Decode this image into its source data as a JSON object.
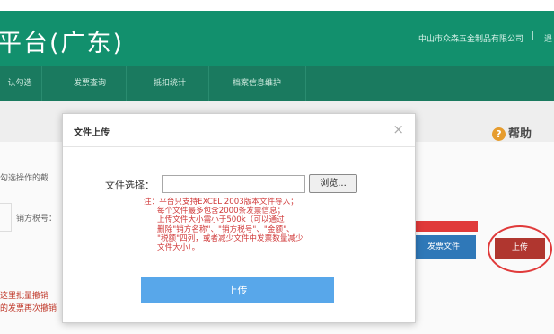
{
  "header": {
    "title": "平台(广东)",
    "company": "中山市众森五金制品有限公司",
    "separator": "|",
    "logout": "退"
  },
  "nav": {
    "items": [
      "认勾选",
      "发票查询",
      "抵扣统计",
      "档案信息维护"
    ]
  },
  "help": {
    "label": "帮助",
    "icon": "help-icon"
  },
  "background": {
    "hint_top": "勾选操作的截",
    "seller_tax_label": "销方税号：",
    "batch_line1": "这里批量撤销",
    "batch_line2": "的发票再次撤销",
    "import_button": "发票文件",
    "upload_button": "上传"
  },
  "modal": {
    "title": "文件上传",
    "close": "×",
    "file_label": "文件选择：",
    "file_value": "",
    "browse": "浏览...",
    "note": [
      "注：平台只支持EXCEL 2003版本文件导入；",
      "每个文件最多包含2000条发票信息；",
      "上传文件大小需小于500k（可以通过",
      "删除\"销方名称\"、\"销方税号\"、\"金额\"、",
      "\"税额\"四列，或者减少文件中发票数量减少",
      "文件大小）。"
    ],
    "upload": "上传"
  },
  "colors": {
    "header": "#12906d",
    "nav": "#1a7a5f",
    "primary_button": "#58a7ea",
    "annotation": "#e03a3a"
  }
}
